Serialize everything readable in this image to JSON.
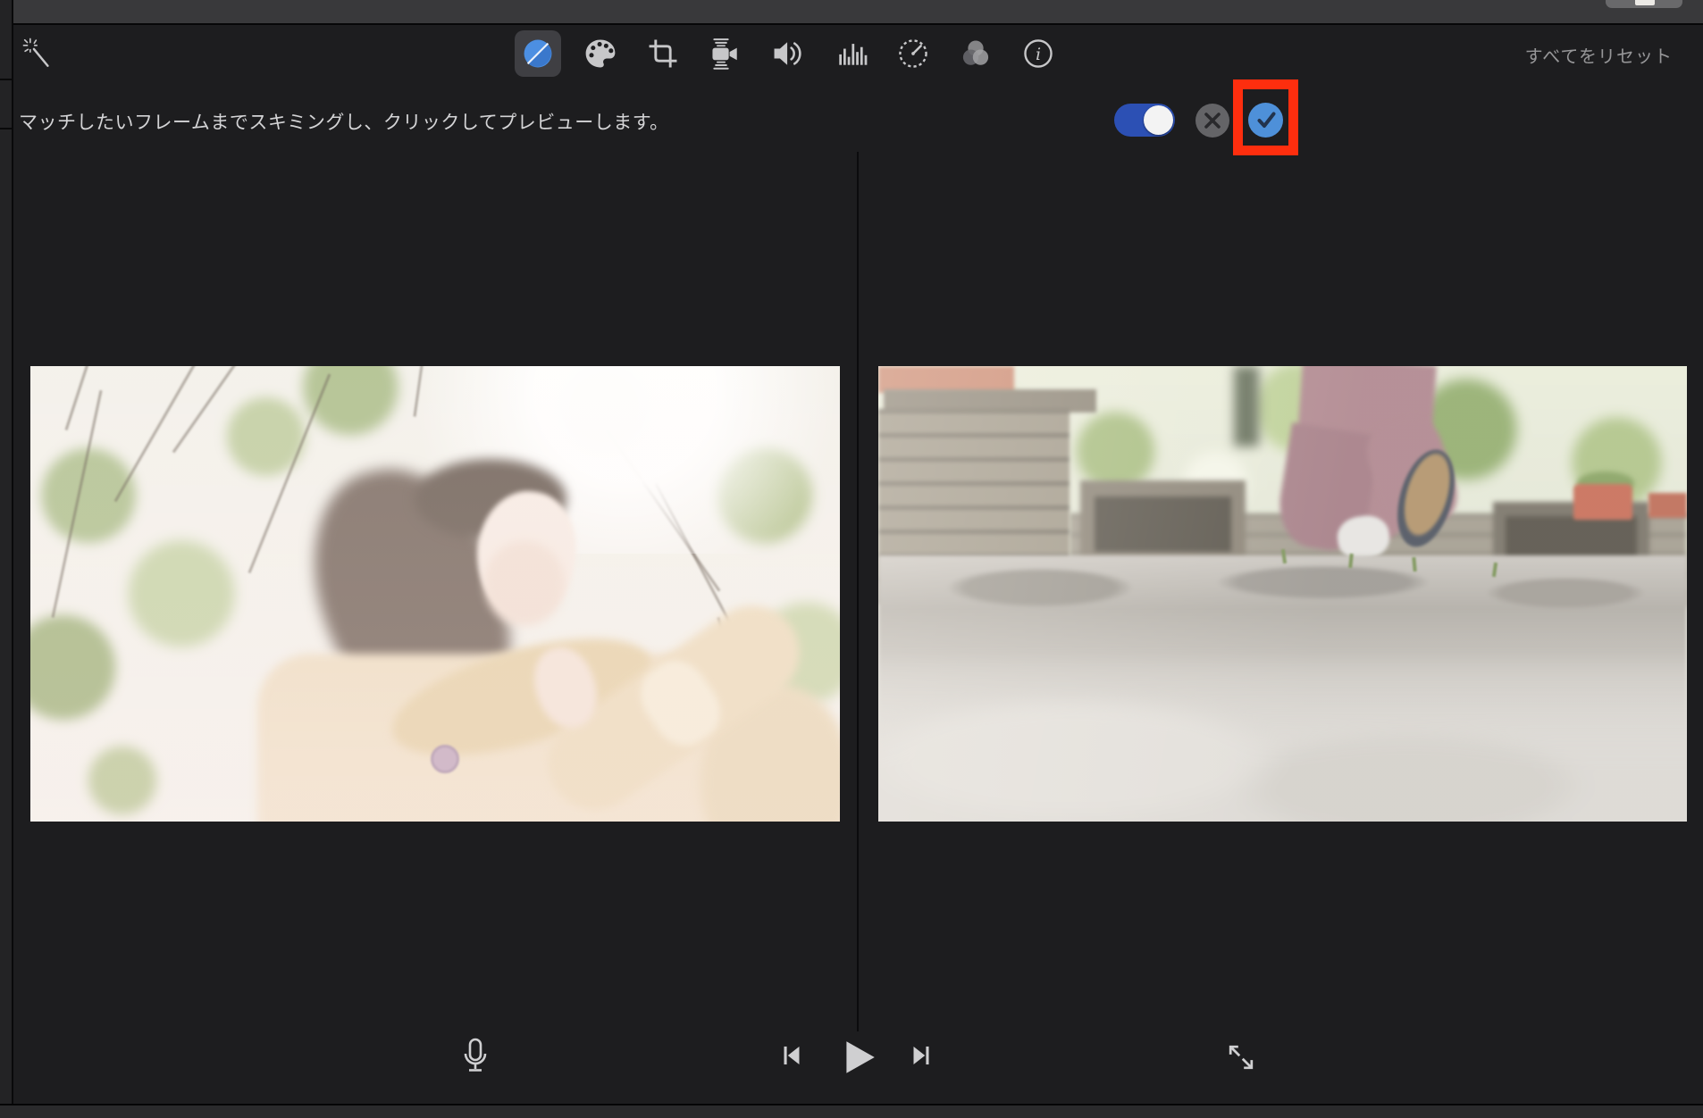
{
  "window": {
    "app": "imovie-clip-viewer",
    "colors": {
      "background": "#1d1d1f",
      "topbar": "#39393b",
      "bottom_strip": "#2a2a2c",
      "icon_gray": "#c7c7c9",
      "selected_tool_bg": "#3f3f43"
    }
  },
  "toolbar": {
    "enhance_icon": "magic-wand",
    "tools": [
      {
        "name": "color-balance",
        "icon": "split-blue-circle",
        "selected": true
      },
      {
        "name": "color-correction",
        "icon": "palette",
        "selected": false
      },
      {
        "name": "crop",
        "icon": "crop-frame",
        "selected": false
      },
      {
        "name": "stabilization",
        "icon": "shaking-camera",
        "selected": false
      },
      {
        "name": "volume",
        "icon": "speaker-waves",
        "selected": false
      },
      {
        "name": "noise-reduction",
        "icon": "equalizer-bars",
        "selected": false
      },
      {
        "name": "speed",
        "icon": "speedometer",
        "selected": false
      },
      {
        "name": "clip-filter",
        "icon": "three-overlapping-circles",
        "selected": false
      },
      {
        "name": "info",
        "icon": "info-circle",
        "selected": false
      }
    ],
    "reset_label": "すべてをリセット"
  },
  "match_bar": {
    "instruction": "マッチしたいフレームまでスキミングし、クリックしてプレビューします。",
    "toggle": {
      "state": "on",
      "track_color": "#2c50b4",
      "knob_color": "#f3f3f3"
    },
    "cancel_button": {
      "icon": "x-circle",
      "color": "#646467"
    },
    "confirm_button": {
      "icon": "check-circle",
      "color": "#4e90d9"
    },
    "highlight_box": {
      "color": "#fe2e0e",
      "around": "confirm_button"
    }
  },
  "viewer": {
    "left_video": {
      "content": "backlit woman in beige hooded coat looking up, blurred spring trees"
    },
    "right_video": {
      "content": "low-angle stone pavement, person in mauve pants stepping away, benches and planters"
    }
  },
  "transport": {
    "voiceover_icon": "microphone",
    "previous_icon": "skip-back",
    "play_icon": "play-triangle",
    "next_icon": "skip-forward",
    "fullscreen_icon": "diagonal-expand-arrows"
  }
}
